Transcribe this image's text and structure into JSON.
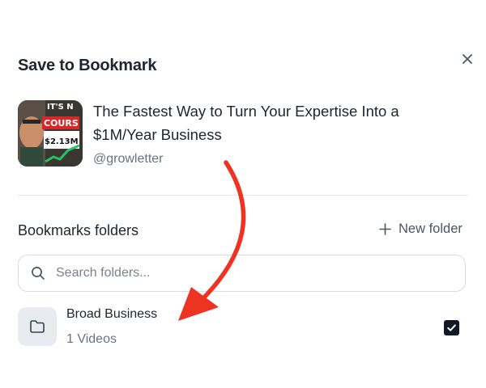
{
  "dialog": {
    "title": "Save to Bookmark",
    "close_icon": "close-icon"
  },
  "video": {
    "title": "The Fastest Way to Turn Your Expertise Into a $1M/Year Business",
    "author": "@growletter",
    "thumbnail_text": {
      "top": "IT'S N",
      "course": "COURS",
      "amount": "$2.13M"
    }
  },
  "folders_section": {
    "label": "Bookmarks folders",
    "new_folder_label": "New folder",
    "new_folder_icon": "plus-icon"
  },
  "search": {
    "placeholder": "Search folders...",
    "value": "",
    "icon": "search-icon"
  },
  "folders": [
    {
      "name": "Broad Business",
      "count": "1 Videos",
      "icon": "folder-icon",
      "checked": true
    }
  ],
  "colors": {
    "text_primary": "#1f2430",
    "text_secondary": "#6b7280",
    "annotation_arrow": "#ee3322",
    "checkbox": "#111827"
  }
}
